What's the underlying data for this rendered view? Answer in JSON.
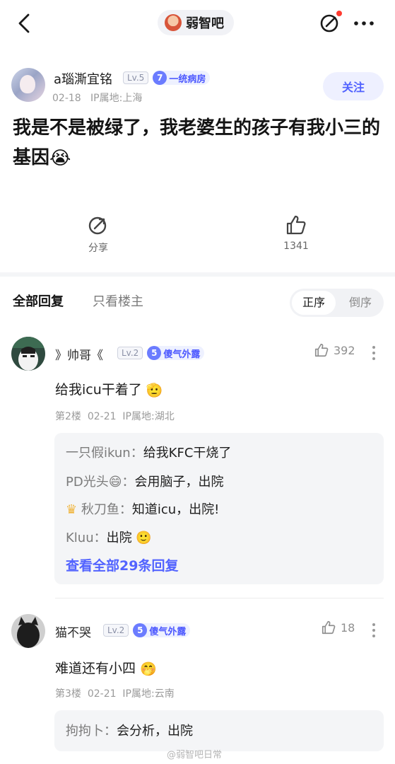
{
  "topbar": {
    "forum_name": "弱智吧"
  },
  "post": {
    "author": {
      "name": "a瑙澌宜铭",
      "level": "Lv.5",
      "group_level": "7",
      "group_name": "一统病房",
      "date": "02-18",
      "ip": "IP属地:上海"
    },
    "follow_label": "关注",
    "title_text": "我是不是被绿了，我老婆生的孩子有我小三的基因",
    "title_emoji": "😭",
    "share_label": "分享",
    "like_count": "1341"
  },
  "tabs": {
    "all_label": "全部回复",
    "owner_label": "只看楼主",
    "order_asc": "正序",
    "order_desc": "倒序"
  },
  "comments": [
    {
      "name": "》帅哥《",
      "level": "Lv.2",
      "group_level": "5",
      "group_name": "傻气外露",
      "likes": "392",
      "text": "给我icu干着了",
      "text_emoji": "🫡",
      "floor": "第2楼",
      "date": "02-21",
      "ip": "IP属地:湖北",
      "replies": [
        {
          "user": "一只假ikun",
          "sep": "：",
          "text": "给我KFC干烧了"
        },
        {
          "user": "PD光头😄",
          "sep": "：",
          "text": "会用脑子，出院"
        },
        {
          "user": "秋刀鱼",
          "sep": "：",
          "text": "知道icu，出院!"
        },
        {
          "user": "Kluu",
          "sep": "：",
          "text": "出院 🙂"
        }
      ],
      "view_all": "查看全部29条回复"
    },
    {
      "name": "猫不哭",
      "level": "Lv.2",
      "group_level": "5",
      "group_name": "傻气外露",
      "likes": "18",
      "text": "难道还有小四",
      "text_emoji": "🤭",
      "floor": "第3楼",
      "date": "02-21",
      "ip": "IP属地:云南",
      "replies": [
        {
          "user": "拘拘卜",
          "sep": "：",
          "text": "会分析，出院"
        }
      ]
    }
  ],
  "watermark": "@弱智吧日常",
  "colors": {
    "accent": "#5263ff",
    "badge_bg": "#eef1ff",
    "reply_bg": "#f4f5f7"
  }
}
